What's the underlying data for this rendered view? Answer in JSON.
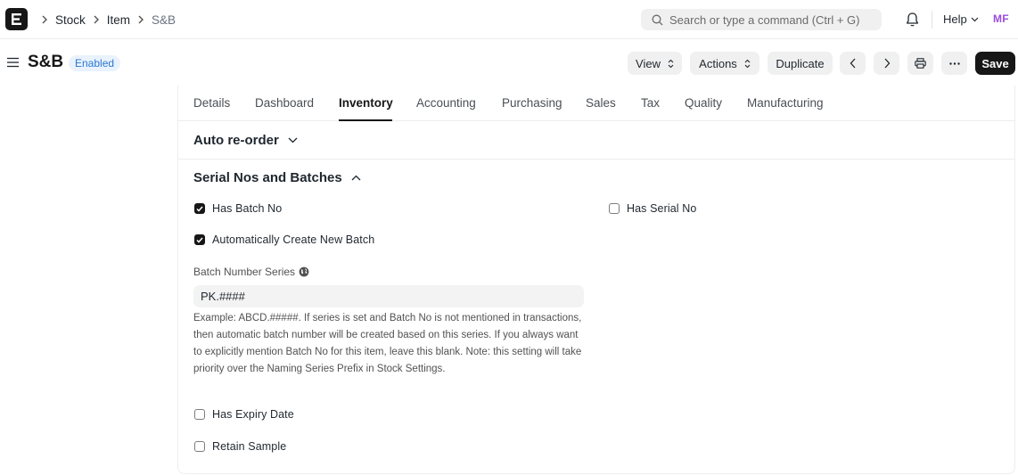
{
  "navbar": {
    "breadcrumbs": [
      "Stock",
      "Item",
      "S&B"
    ],
    "search_placeholder": "Search or type a command (Ctrl + G)",
    "help_label": "Help",
    "avatar_initials": "MF"
  },
  "page": {
    "title": "S&B",
    "status": "Enabled"
  },
  "toolbar": {
    "view_label": "View",
    "actions_label": "Actions",
    "duplicate_label": "Duplicate",
    "save_label": "Save"
  },
  "tabs": [
    {
      "label": "Details",
      "active": false
    },
    {
      "label": "Dashboard",
      "active": false
    },
    {
      "label": "Inventory",
      "active": true
    },
    {
      "label": "Accounting",
      "active": false
    },
    {
      "label": "Purchasing",
      "active": false
    },
    {
      "label": "Sales",
      "active": false
    },
    {
      "label": "Tax",
      "active": false
    },
    {
      "label": "Quality",
      "active": false
    },
    {
      "label": "Manufacturing",
      "active": false
    }
  ],
  "sections": {
    "auto_reorder": {
      "title": "Auto re-order",
      "collapsed": true
    },
    "serial_batches": {
      "title": "Serial Nos and Batches",
      "collapsed": false
    }
  },
  "fields": {
    "has_batch_no": {
      "label": "Has Batch No",
      "checked": true
    },
    "has_serial_no": {
      "label": "Has Serial No",
      "checked": false
    },
    "auto_create_batch": {
      "label": "Automatically Create New Batch",
      "checked": true
    },
    "batch_number_series": {
      "label": "Batch Number Series",
      "value": "PK.####",
      "description": "Example: ABCD.#####. If series is set and Batch No is not mentioned in transactions, then automatic batch number will be created based on this series. If you always want to explicitly mention Batch No for this item, leave this blank. Note: this setting will take priority over the Naming Series Prefix in Stock Settings."
    },
    "has_expiry_date": {
      "label": "Has Expiry Date",
      "checked": false
    },
    "retain_sample": {
      "label": "Retain Sample",
      "checked": false
    }
  },
  "colors": {
    "primary": "#171717",
    "badge_bg": "#e9f2fd",
    "badge_text": "#2b78d3",
    "avatar": "#9b4dde"
  }
}
